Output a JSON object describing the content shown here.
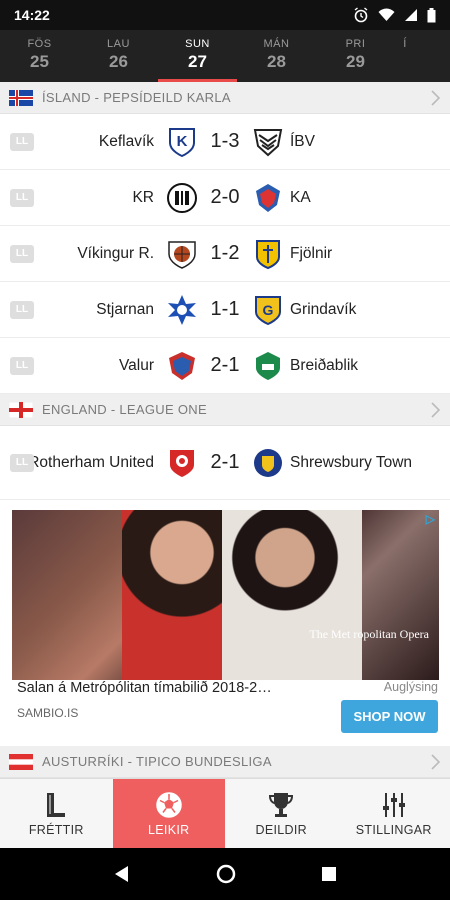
{
  "status": {
    "time": "14:22"
  },
  "dates": [
    {
      "day": "FÖS",
      "num": "25"
    },
    {
      "day": "LAU",
      "num": "26"
    },
    {
      "day": "SUN",
      "num": "27"
    },
    {
      "day": "MÁN",
      "num": "28"
    },
    {
      "day": "PRI",
      "num": "29"
    },
    {
      "day": "Í",
      "num": ""
    }
  ],
  "leagues": [
    {
      "name": "ÍSLAND - PEPSÍDEILD KARLA",
      "flag": "iceland"
    },
    {
      "name": "ENGLAND - LEAGUE ONE",
      "flag": "england"
    },
    {
      "name": "AUSTURRÍKI - TIPICO BUNDESLIGA",
      "flag": "austria"
    }
  ],
  "badge": "LL",
  "matches": [
    {
      "home": "Keflavík",
      "score": "1-3",
      "away": "ÍBV"
    },
    {
      "home": "KR",
      "score": "2-0",
      "away": "KA"
    },
    {
      "home": "Víkingur R.",
      "score": "1-2",
      "away": "Fjölnir"
    },
    {
      "home": "Stjarnan",
      "score": "1-1",
      "away": "Grindavík"
    },
    {
      "home": "Valur",
      "score": "2-1",
      "away": "Breiðablik"
    },
    {
      "home": "Rotherham United",
      "score": "2-1",
      "away": "Shrewsbury Town"
    }
  ],
  "ad": {
    "title": "Salan á Metrópólitan tímabilið 2018-2…",
    "label": "Auglýsing",
    "source": "SAMBIO.IS",
    "button": "SHOP NOW",
    "image_text": "The Met ropolitan Opera"
  },
  "bottom_nav": [
    {
      "label": "FRÉTTIR",
      "icon": "news-icon"
    },
    {
      "label": "LEIKIR",
      "icon": "soccer-ball-icon"
    },
    {
      "label": "DEILDIR",
      "icon": "trophy-icon"
    },
    {
      "label": "STILLINGAR",
      "icon": "sliders-icon"
    }
  ],
  "colors": {
    "accent": "#ef5f5f",
    "ad_button": "#3ea6dc"
  }
}
